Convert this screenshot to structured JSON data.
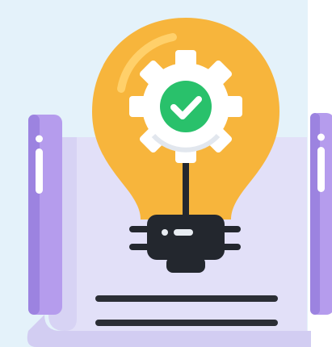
{
  "illustration": {
    "subject": "lightbulb-gear-check-icon",
    "colors": {
      "background": "#e4f2fa",
      "scroll_paper": "#e2e0f8",
      "scroll_roll": "#b59ced",
      "scroll_roll_dark": "#9c83e0",
      "bulb": "#f7b53c",
      "bulb_highlight": "#ffd06a",
      "gear": "#ffffff",
      "gear_shadow": "#e2e7ee",
      "check_badge": "#29c16b",
      "check_mark": "#ffffff",
      "base": "#23272e",
      "base_highlight": "#e8ecf2",
      "text_lines": "#2b2e35"
    }
  }
}
